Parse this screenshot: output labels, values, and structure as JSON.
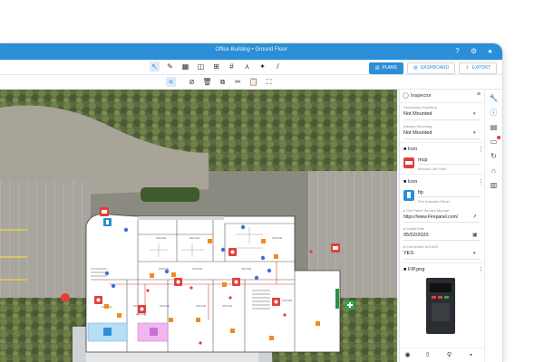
{
  "window": {
    "title": "Office Building • Ground Floor"
  },
  "titlebar_icons": [
    "help-icon",
    "settings-icon",
    "user-icon"
  ],
  "modes": [
    {
      "label": "PLANS",
      "active": true
    },
    {
      "label": "DASHBOARD",
      "active": false
    },
    {
      "label": "EXPORT",
      "active": false
    }
  ],
  "toolbar_main": [
    "select-icon",
    "pen-icon",
    "grid-icon",
    "page-icon",
    "measure-icon",
    "hash-icon",
    "nodes-icon",
    "pin-icon",
    "brush-icon"
  ],
  "toolbar_edit": [
    "fit-icon",
    "crop-icon",
    "trash-icon",
    "copy-icon",
    "cut-icon",
    "clipboard-icon",
    "expand-icon"
  ],
  "map": {
    "rooms": [
      "OFFICE",
      "OFFICE",
      "OFFICE",
      "OFFICE",
      "OFFICE",
      "OFFICE",
      "OFFICE",
      "OFFICE",
      "OFFICE",
      "OFFICE",
      "OFFICE",
      "OFFICE",
      "OFFICE"
    ]
  },
  "inspector": {
    "title": "Inspector",
    "fields": {
      "secondary_mounting_label": "Secondary Mounting",
      "secondary_mounting_value": "Not Mounted",
      "artwork_mounting_label": "Artwork Mounting",
      "artwork_mounting_value": "Not Mounted"
    },
    "icon1": {
      "section": "Icon",
      "name": "mcp",
      "desc": "Manual Call Point"
    },
    "icon2": {
      "section": "Icon",
      "name": "fip",
      "desc": "Fire Indicator Panel"
    },
    "manual": {
      "label": "Fire Panel Service Manual",
      "value": "https://www.Firepanel.com/"
    },
    "install": {
      "label": "Install Date",
      "value": "05/02/2020"
    },
    "ewis": {
      "label": "Connected to EWIS",
      "value": "YES"
    },
    "image": {
      "filename": "FIP.png"
    },
    "bottom_icons": [
      "camera-icon",
      "upload-icon",
      "location-icon",
      "save-icon"
    ]
  },
  "rail_icons": [
    "wrench-icon",
    "info-icon",
    "list-icon",
    "chat-icon",
    "history-icon",
    "magnet-icon",
    "layers-icon"
  ],
  "colors": {
    "accent": "#2c8ed6",
    "alert": "#e0403a",
    "hazard": "#f08a24",
    "marker": "#3d6fd8"
  }
}
